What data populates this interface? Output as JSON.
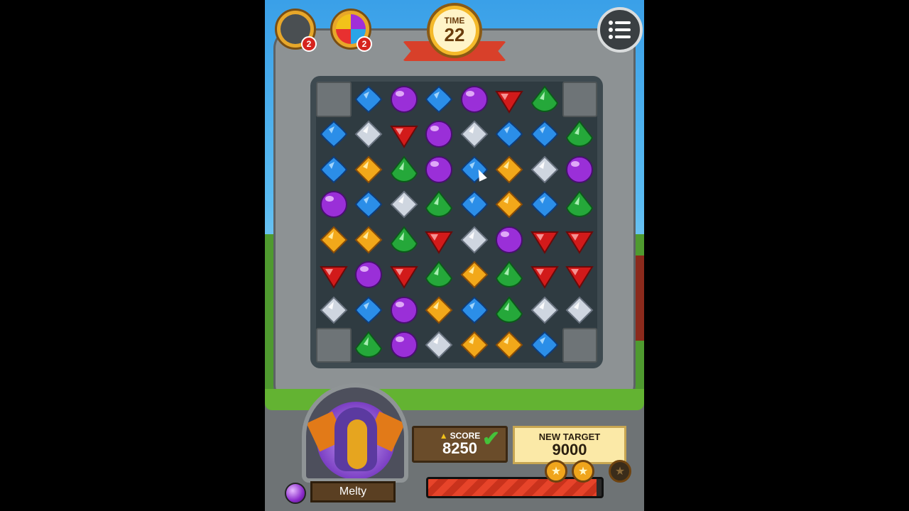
{
  "hud": {
    "time_label": "TIME",
    "time_value": "22",
    "boosters": [
      {
        "name": "hammer-booster",
        "count": "2"
      },
      {
        "name": "star-bomb-booster",
        "count": "2"
      }
    ],
    "menu_icon": "menu-icon"
  },
  "board": {
    "rows": [
      [
        "block",
        "blue",
        "purple",
        "blue",
        "purple",
        "red",
        "green",
        "block"
      ],
      [
        "blue",
        "white",
        "red",
        "purple",
        "white",
        "blue",
        "blue",
        "green"
      ],
      [
        "blue",
        "yellow",
        "green",
        "purple",
        "blue",
        "yellow",
        "white",
        "purple"
      ],
      [
        "purple",
        "blue",
        "white",
        "green",
        "blue",
        "yellow",
        "blue",
        "green"
      ],
      [
        "yellow",
        "yellow",
        "green",
        "red",
        "white",
        "purple",
        "red",
        "red"
      ],
      [
        "red",
        "purple",
        "red",
        "green",
        "yellow",
        "green",
        "red",
        "red"
      ],
      [
        "white",
        "blue",
        "purple",
        "yellow",
        "blue",
        "green",
        "white",
        "white"
      ],
      [
        "block",
        "green",
        "purple",
        "white",
        "yellow",
        "yellow",
        "blue",
        "block"
      ]
    ]
  },
  "gem_colors": {
    "blue": "#2b8ee8",
    "purple": "#9a2fd8",
    "red": "#d21a1a",
    "green": "#25a83a",
    "white": "#cfd6e0",
    "yellow": "#f2a81a"
  },
  "character": {
    "name": "Melty"
  },
  "score": {
    "label": "SCORE",
    "value": "8250"
  },
  "target": {
    "label": "NEW TARGET",
    "value": "9000"
  },
  "progress": {
    "fraction": 0.97
  },
  "stars": [
    {
      "earned": true
    },
    {
      "earned": true
    },
    {
      "earned": false
    }
  ]
}
